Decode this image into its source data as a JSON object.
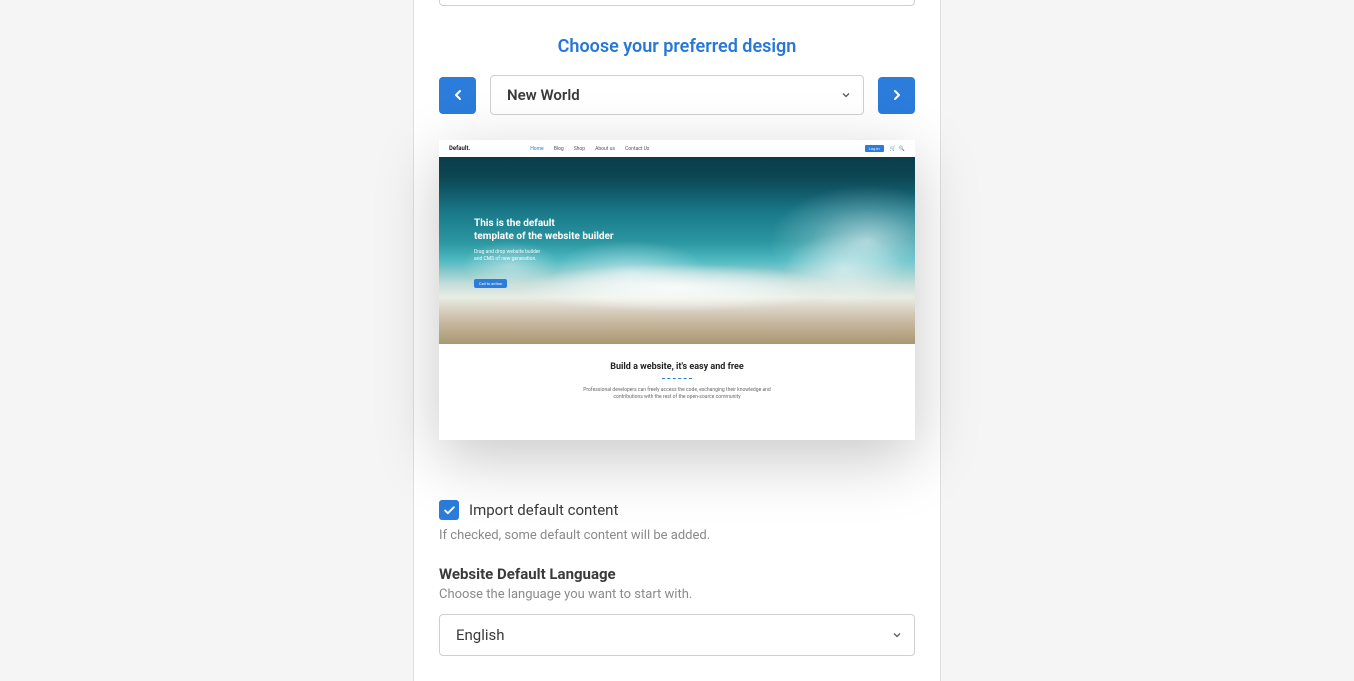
{
  "design": {
    "title": "Choose your preferred design",
    "selected": "New World"
  },
  "preview": {
    "logo": "Default.",
    "nav": [
      "Home",
      "Blog",
      "Shop",
      "About us",
      "Contact Us"
    ],
    "login": "Log in",
    "hero_title_line1": "This is the default",
    "hero_title_line2": "template of the website builder",
    "hero_sub_line1": "Drag and drop website builder",
    "hero_sub_line2": "and CMS of new generation.",
    "cta": "Call to action",
    "bottom_title": "Build a website, it's easy and free",
    "bottom_text": "Professional developers can freely access the code, exchanging their knowledge and contributions with the rest of the open-source community"
  },
  "import": {
    "label": "Import default content",
    "helper": "If checked, some default content will be added.",
    "checked": true
  },
  "language": {
    "label": "Website Default Language",
    "helper": "Choose the language you want to start with.",
    "selected": "English"
  }
}
